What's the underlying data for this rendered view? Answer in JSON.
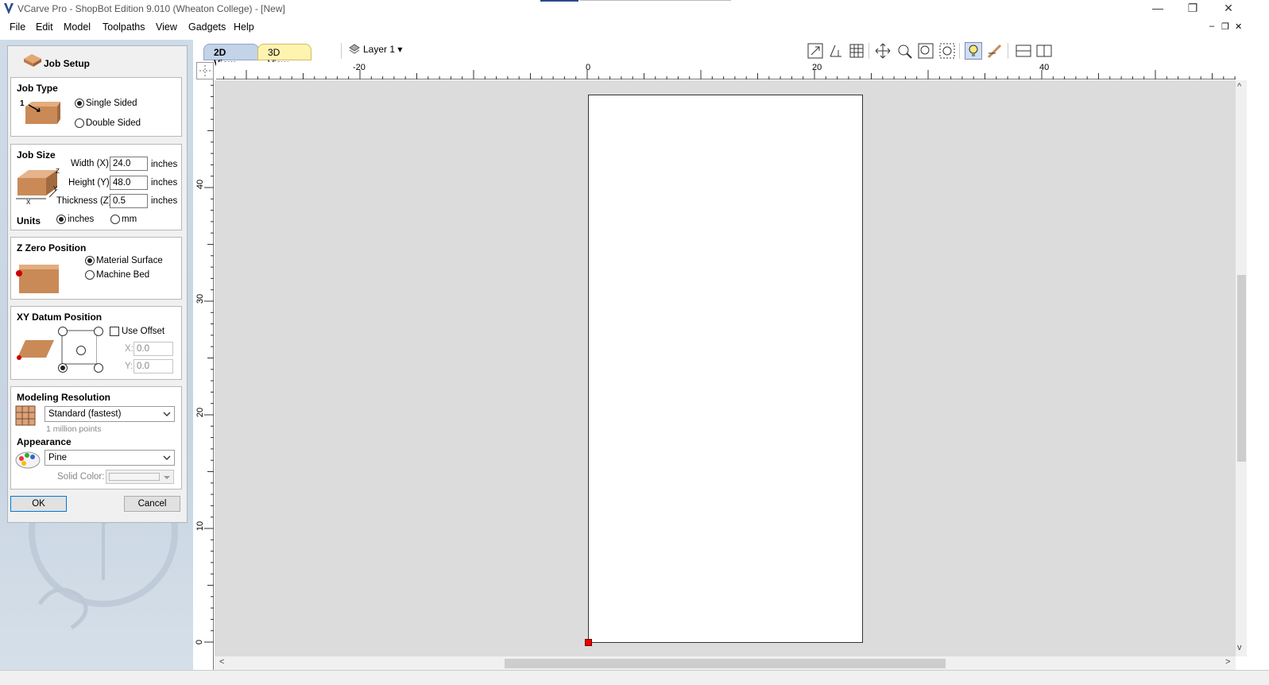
{
  "window": {
    "title": "VCarve Pro - ShopBot Edition 9.010 (Wheaton College) - [New]",
    "minimize": "—",
    "restore": "❐",
    "close": "✕"
  },
  "menu": {
    "items": [
      "File",
      "Edit",
      "Model",
      "Toolpaths",
      "View",
      "Gadgets",
      "Help"
    ],
    "mdi": {
      "minimize": "–",
      "restore": "❐",
      "close": "✕"
    }
  },
  "view_tabs": {
    "tab_2d": "2D View",
    "tab_3d": "3D View"
  },
  "layer": {
    "label": "Layer 1",
    "arrow": "▾"
  },
  "toolbar_icons": [
    "zoom-extents-icon",
    "snap-icon",
    "grid-icon",
    "pan-icon",
    "zoom-window-icon",
    "zoom-in-icon",
    "zoom-out-icon",
    "light-bulb-icon",
    "toolpath-icon",
    "split-view-icon",
    "side-view-icon"
  ],
  "job_setup": {
    "title": "Job Setup",
    "job_type": {
      "title": "Job Type",
      "single": "Single Sided",
      "double": "Double Sided",
      "selected": "Single Sided",
      "badge": "1"
    },
    "job_size": {
      "title": "Job Size",
      "width_label": "Width (X):",
      "width_value": "24.0",
      "height_label": "Height (Y):",
      "height_value": "48.0",
      "thickness_label": "Thickness (Z):",
      "thickness_value": "0.5",
      "unit": "inches",
      "units_label": "Units",
      "unit_inches": "inches",
      "unit_mm": "mm",
      "selected_unit": "inches",
      "axis_z": "Z",
      "axis_y": "Y",
      "axis_x": "X"
    },
    "z_zero": {
      "title": "Z Zero Position",
      "material": "Material Surface",
      "bed": "Machine Bed",
      "selected": "Material Surface"
    },
    "xy_datum": {
      "title": "XY Datum Position",
      "use_offset": "Use Offset",
      "use_offset_checked": false,
      "x_label": "X:",
      "x_value": "0.0",
      "y_label": "Y:",
      "y_value": "0.0",
      "selected_corner": "bottom-left"
    },
    "modeling": {
      "title": "Modeling Resolution",
      "value": "Standard (fastest)",
      "note": "1 million points"
    },
    "appearance": {
      "title": "Appearance",
      "value": "Pine",
      "solid_color_label": "Solid Color:"
    },
    "ok": "OK",
    "cancel": "Cancel"
  },
  "rulers": {
    "top_labels": [
      "-20",
      "0",
      "20",
      "40"
    ],
    "left_labels": [
      "40",
      "30",
      "20",
      "10",
      "0"
    ]
  },
  "scroll_arrows": {
    "left": "<",
    "right": ">",
    "up": "^",
    "down": "v"
  }
}
